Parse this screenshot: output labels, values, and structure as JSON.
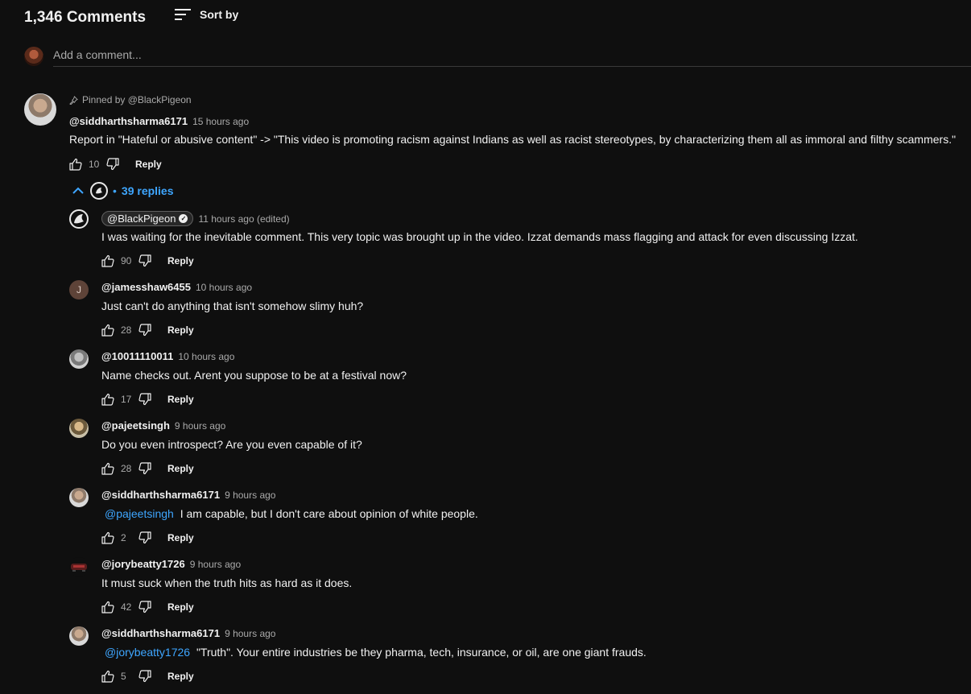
{
  "header": {
    "comment_count": "1,346 Comments",
    "sort_label": "Sort by"
  },
  "add_comment": {
    "placeholder": "Add a comment..."
  },
  "top_comment": {
    "pinned_text": "Pinned by @BlackPigeon",
    "author": "@siddharthsharma6171",
    "time": "15 hours ago",
    "text": "Report in \"Hateful or abusive content\" -> \"This video is promoting racism against Indians as well as racist stereotypes, by characterizing them all as immoral and filthy scammers.\"",
    "likes": "10",
    "reply_label": "Reply",
    "replies_label": "39 replies",
    "replies_separator": "•"
  },
  "replies": [
    {
      "author": "@BlackPigeon",
      "time": "11 hours ago (edited)",
      "mention": "",
      "text": "I was waiting for the inevitable comment. This very topic was brought up in the video. Izzat demands mass flagging and attack for even discussing Izzat.",
      "likes": "90",
      "reply_label": "Reply"
    },
    {
      "author": "@jamesshaw6455",
      "time": "10 hours ago",
      "mention": "",
      "text": "Just can't do anything that isn't somehow slimy huh?",
      "likes": "28",
      "reply_label": "Reply",
      "avatar_letter": "J"
    },
    {
      "author": "@10011110011",
      "time": "10 hours ago",
      "mention": "",
      "text": "Name checks out. Arent you suppose to be at a festival now?",
      "likes": "17",
      "reply_label": "Reply"
    },
    {
      "author": "@pajeetsingh",
      "time": "9 hours ago",
      "mention": "",
      "text": "Do you even introspect? Are you even capable of it?",
      "likes": "28",
      "reply_label": "Reply"
    },
    {
      "author": "@siddharthsharma6171",
      "time": "9 hours ago",
      "mention": "@pajeetsingh",
      "text": "I am capable, but I don't care about opinion of white people.",
      "likes": "2",
      "reply_label": "Reply"
    },
    {
      "author": "@jorybeatty1726",
      "time": "9 hours ago",
      "mention": "",
      "text": "It must suck when the truth hits as hard as it does.",
      "likes": "42",
      "reply_label": "Reply"
    },
    {
      "author": "@siddharthsharma6171",
      "time": "9 hours ago",
      "mention": "@jorybeatty1726",
      "text": "\"Truth\". Your entire industries be they pharma, tech, insurance, or oil, are one giant frauds.",
      "likes": "5",
      "reply_label": "Reply"
    }
  ],
  "colors": {
    "background": "#0f0f0f",
    "text": "#f1f1f1",
    "secondary": "#aaaaaa",
    "link": "#3ea6ff"
  },
  "icons": [
    "sort-icon",
    "pin-icon",
    "like-icon",
    "dislike-icon",
    "chevron-up-icon",
    "verified-icon"
  ]
}
